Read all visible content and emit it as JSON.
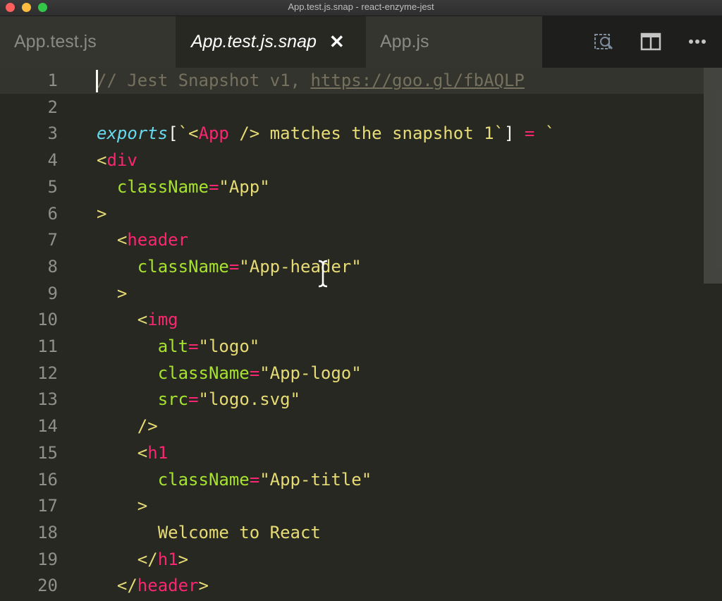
{
  "window": {
    "title": "App.test.js.snap - react-enzyme-jest"
  },
  "tabs": [
    {
      "label": "App.test.js",
      "active": false
    },
    {
      "label": "App.test.js.snap",
      "active": true,
      "close_icon": "close-icon"
    },
    {
      "label": "App.js",
      "active": false
    }
  ],
  "toolbar_icons": [
    "open-changes-icon",
    "split-editor-icon",
    "more-actions-icon"
  ],
  "colors": {
    "background": "#272822",
    "tag": "#f92672",
    "string": "#e6db74",
    "attribute": "#a6e22e",
    "keyword": "#66d9ef",
    "comment": "#75715e"
  },
  "editor": {
    "lines": [
      {
        "num": "1",
        "tokens": [
          {
            "t": "// Jest Snapshot v1, ",
            "c": "comment"
          },
          {
            "t": "https://goo.gl/fbAQLP",
            "c": "link"
          }
        ]
      },
      {
        "num": "2",
        "tokens": []
      },
      {
        "num": "3",
        "tokens": [
          {
            "t": "exports",
            "c": "var"
          },
          {
            "t": "[",
            "c": "punct"
          },
          {
            "t": "`<",
            "c": "str"
          },
          {
            "t": "App",
            "c": "tag"
          },
          {
            "t": " /> matches the snapshot 1`",
            "c": "str"
          },
          {
            "t": "] ",
            "c": "punct"
          },
          {
            "t": "=",
            "c": "op"
          },
          {
            "t": " `",
            "c": "str"
          }
        ]
      },
      {
        "num": "4",
        "tokens": [
          {
            "t": "<",
            "c": "str"
          },
          {
            "t": "div",
            "c": "tag"
          }
        ]
      },
      {
        "num": "5",
        "tokens": [
          {
            "t": "  ",
            "c": "plain"
          },
          {
            "t": "className",
            "c": "attr"
          },
          {
            "t": "=",
            "c": "op"
          },
          {
            "t": "\"App\"",
            "c": "str"
          }
        ]
      },
      {
        "num": "6",
        "tokens": [
          {
            "t": ">",
            "c": "str"
          }
        ]
      },
      {
        "num": "7",
        "tokens": [
          {
            "t": "  <",
            "c": "str"
          },
          {
            "t": "header",
            "c": "tag"
          }
        ]
      },
      {
        "num": "8",
        "tokens": [
          {
            "t": "    ",
            "c": "plain"
          },
          {
            "t": "className",
            "c": "attr"
          },
          {
            "t": "=",
            "c": "op"
          },
          {
            "t": "\"App-header\"",
            "c": "str"
          }
        ]
      },
      {
        "num": "9",
        "tokens": [
          {
            "t": "  >",
            "c": "str"
          }
        ]
      },
      {
        "num": "10",
        "tokens": [
          {
            "t": "    <",
            "c": "str"
          },
          {
            "t": "img",
            "c": "tag"
          }
        ]
      },
      {
        "num": "11",
        "tokens": [
          {
            "t": "      ",
            "c": "plain"
          },
          {
            "t": "alt",
            "c": "attr"
          },
          {
            "t": "=",
            "c": "op"
          },
          {
            "t": "\"logo\"",
            "c": "str"
          }
        ]
      },
      {
        "num": "12",
        "tokens": [
          {
            "t": "      ",
            "c": "plain"
          },
          {
            "t": "className",
            "c": "attr"
          },
          {
            "t": "=",
            "c": "op"
          },
          {
            "t": "\"App-logo\"",
            "c": "str"
          }
        ]
      },
      {
        "num": "13",
        "tokens": [
          {
            "t": "      ",
            "c": "plain"
          },
          {
            "t": "src",
            "c": "attr"
          },
          {
            "t": "=",
            "c": "op"
          },
          {
            "t": "\"logo.svg\"",
            "c": "str"
          }
        ]
      },
      {
        "num": "14",
        "tokens": [
          {
            "t": "    />",
            "c": "str"
          }
        ]
      },
      {
        "num": "15",
        "tokens": [
          {
            "t": "    <",
            "c": "str"
          },
          {
            "t": "h1",
            "c": "tag"
          }
        ]
      },
      {
        "num": "16",
        "tokens": [
          {
            "t": "      ",
            "c": "plain"
          },
          {
            "t": "className",
            "c": "attr"
          },
          {
            "t": "=",
            "c": "op"
          },
          {
            "t": "\"App-title\"",
            "c": "str"
          }
        ]
      },
      {
        "num": "17",
        "tokens": [
          {
            "t": "    >",
            "c": "str"
          }
        ]
      },
      {
        "num": "18",
        "tokens": [
          {
            "t": "      Welcome to React",
            "c": "str"
          }
        ]
      },
      {
        "num": "19",
        "tokens": [
          {
            "t": "    </",
            "c": "str"
          },
          {
            "t": "h1",
            "c": "tag"
          },
          {
            "t": ">",
            "c": "str"
          }
        ]
      },
      {
        "num": "20",
        "tokens": [
          {
            "t": "  </",
            "c": "str"
          },
          {
            "t": "header",
            "c": "tag"
          },
          {
            "t": ">",
            "c": "str"
          }
        ]
      }
    ]
  }
}
